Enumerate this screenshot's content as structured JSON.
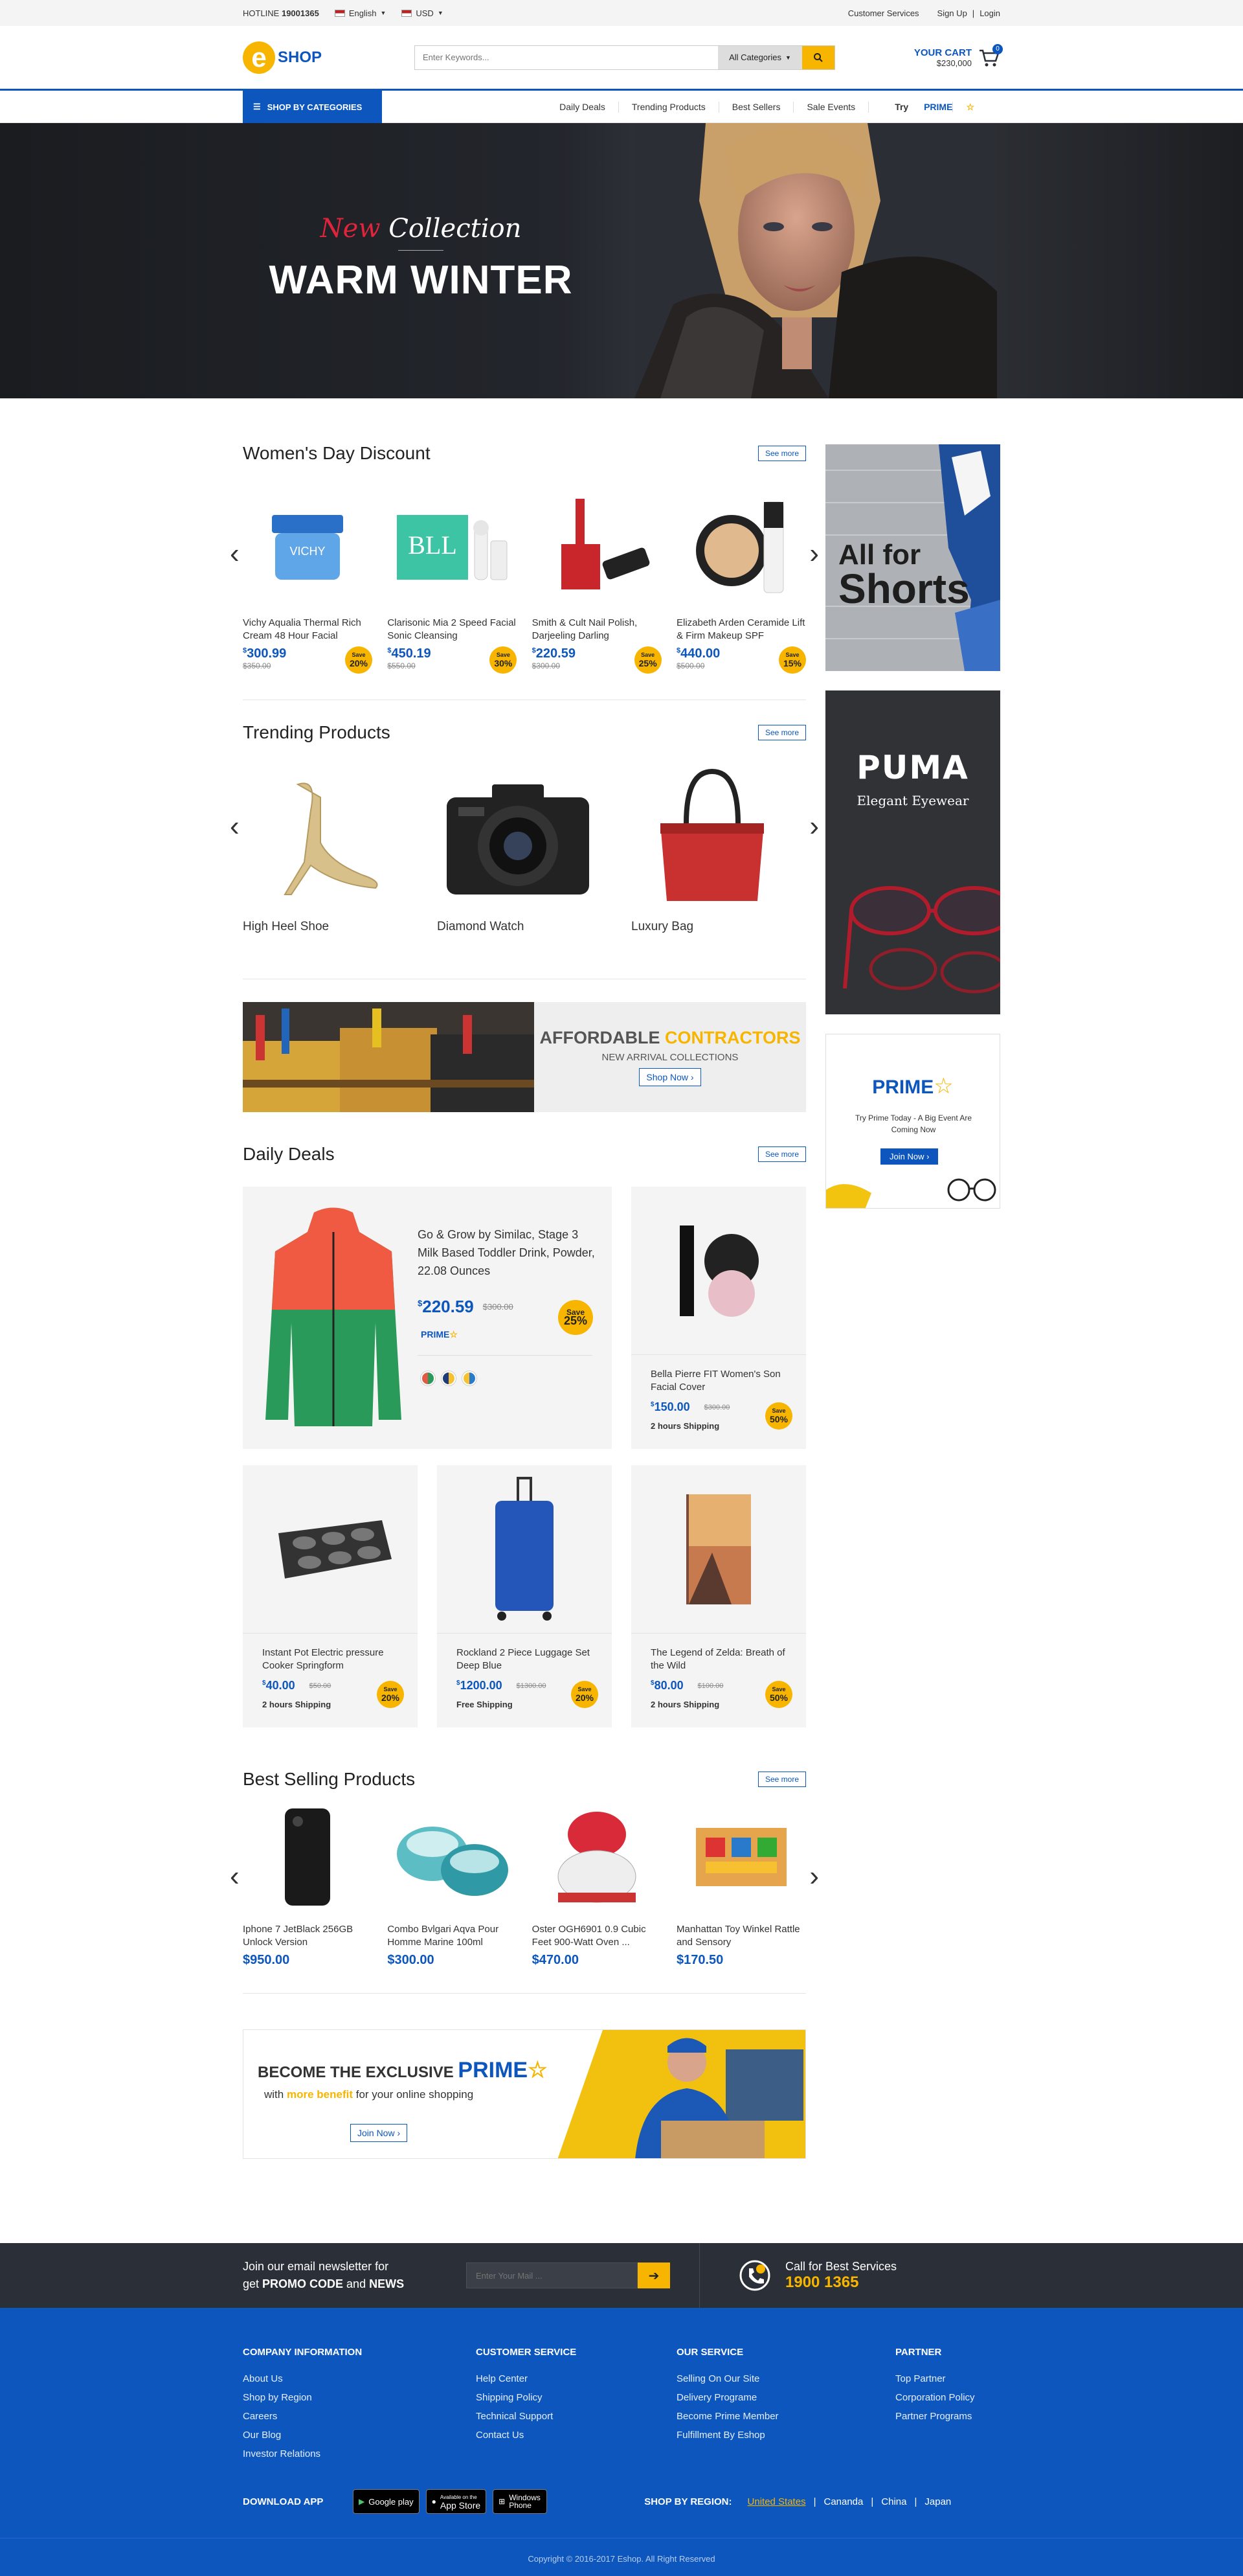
{
  "topbar": {
    "hotline_label": "HOTLINE",
    "hotline_number": "19001365",
    "language": "English",
    "currency": "USD",
    "customer_service": "Customer Services",
    "sign_up": "Sign Up",
    "separator": "|",
    "login": "Login"
  },
  "header": {
    "logo_e": "e",
    "logo_text": "SHOP",
    "search_placeholder": "Enter Keywords...",
    "category": "All Categories",
    "cart_label": "YOUR CART",
    "cart_total": "$230,000",
    "cart_count": "0"
  },
  "nav": {
    "shop_by_categories": "SHOP BY CATEGORIES",
    "links": [
      "Daily Deals",
      "Trending Products",
      "Best Sellers",
      "Sale Events"
    ],
    "try": "Try",
    "prime": "PRIME"
  },
  "hero": {
    "new": "New",
    "collection": " Collection",
    "title": "WARM WINTER"
  },
  "womens_day": {
    "title": "Women's Day Discount",
    "see_more": "See more",
    "products": [
      {
        "name": "Vichy Aqualia Thermal Rich Cream 48 Hour Facial",
        "price": "300.99",
        "old": "$350.00",
        "save": "20%"
      },
      {
        "name": "Clarisonic Mia 2 Speed Facial Sonic Cleansing",
        "price": "450.19",
        "old": "$550.00",
        "save": "30%"
      },
      {
        "name": "Smith & Cult Nail Polish, Darjeeling Darling",
        "price": "220.59",
        "old": "$300.00",
        "save": "25%"
      },
      {
        "name": "Elizabeth Arden Ceramide Lift & Firm Makeup SPF",
        "price": "440.00",
        "old": "$500.00",
        "save": "15%"
      }
    ]
  },
  "trending": {
    "title": "Trending Products",
    "see_more": "See more",
    "products": [
      "High Heel Shoe",
      "Diamond Watch",
      "Luxury Bag"
    ]
  },
  "contractors": {
    "title_a": "AFFORDABLE ",
    "title_b": "CONTRACTORS",
    "subtitle": "NEW ARRIVAL COLLECTIONS",
    "button": "Shop Now"
  },
  "daily_deals": {
    "title": "Daily Deals",
    "see_more": "See more",
    "featured": {
      "name": "Go & Grow by Similac, Stage 3 Milk Based Toddler Drink, Powder, 22.08 Ounces",
      "price": "220.59",
      "old": "$300.00",
      "save": "25%",
      "prime": "PRIME"
    },
    "items": [
      {
        "name": "Bella Pierre FIT Women's Son Facial Cover",
        "price": "150.00",
        "old": "$300.00",
        "save": "50%",
        "ship": "2 hours Shipping"
      },
      {
        "name": "Instant Pot Electric pressure Cooker Springform",
        "price": "40.00",
        "old": "$50.00",
        "save": "20%",
        "ship": "2 hours Shipping"
      },
      {
        "name": "Rockland 2 Piece Luggage Set Deep Blue",
        "price": "1200.00",
        "old": "$1300.00",
        "save": "20%",
        "ship": "Free Shipping"
      },
      {
        "name": "The Legend of Zelda: Breath of the Wild",
        "price": "80.00",
        "old": "$100.00",
        "save": "50%",
        "ship": "2 hours Shipping"
      }
    ]
  },
  "best_selling": {
    "title": "Best Selling Products",
    "see_more": "See more",
    "products": [
      {
        "name": "Iphone 7 JetBlack 256GB Unlock Version",
        "price": "$950.00"
      },
      {
        "name": "Combo Bvlgari Aqva Pour Homme Marine 100ml",
        "price": "$300.00"
      },
      {
        "name": "Oster OGH6901 0.9 Cubic Feet 900-Watt Oven ...",
        "price": "$470.00"
      },
      {
        "name": "Manhattan Toy Winkel Rattle and Sensory",
        "price": "$170.50"
      }
    ]
  },
  "prime_banner": {
    "become": "BECOME THE EXCLUSIVE",
    "prime": "PRIME",
    "with": "with ",
    "more_benefit": "more benefit",
    "for": " for your online shopping",
    "button": "Join Now"
  },
  "sidebar": {
    "shorts_a": "All for",
    "shorts_b": "Shorts",
    "puma": "PUMA",
    "eyewear": "Elegant Eyewear",
    "prime": "PRIME",
    "prime_text": "Try Prime Today - A Big Event Are Coming Now",
    "join": "Join Now"
  },
  "newsletter": {
    "line1": "Join our email newsletter for",
    "get": "get ",
    "promo": "PROMO CODE",
    "and": " and ",
    "news": "NEWS",
    "placeholder": "Enter Your Mail ...",
    "call": "Call for Best Services",
    "phone": "1900 1365"
  },
  "footer": {
    "cols": [
      {
        "title": "COMPANY INFORMATION",
        "items": [
          "About Us",
          "Shop by Region",
          "Careers",
          "Our Blog",
          "Investor Relations"
        ]
      },
      {
        "title": "CUSTOMER SERVICE",
        "items": [
          "Help Center",
          "Shipping Policy",
          "Technical Support",
          "Contact Us"
        ]
      },
      {
        "title": "OUR SERVICE",
        "items": [
          "Selling On Our Site",
          "Delivery Programe",
          "Become Prime Member",
          "Fulfillment By Eshop"
        ]
      },
      {
        "title": "PARTNER",
        "items": [
          "Top Partner",
          "Corporation Policy",
          "Partner Programs"
        ]
      }
    ],
    "download": "DOWNLOAD APP",
    "google": "Google play",
    "appstore": "App Store",
    "appstore_small": "Available on the",
    "windows": "Windows Phone",
    "region_label": "SHOP BY REGION:",
    "regions": [
      "United States",
      "Cananda",
      "China",
      "Japan"
    ],
    "copyright": "Copyright © 2016-2017 Eshop. All Right Reserved"
  },
  "colors": {
    "brand_blue": "#0c56bd",
    "accent_yellow": "#f7b500",
    "dark": "#2b3038"
  }
}
